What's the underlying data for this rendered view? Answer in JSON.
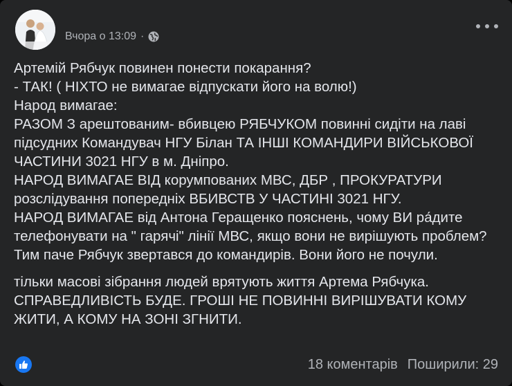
{
  "post": {
    "timestamp": "Вчора о 13:09",
    "separator": "·",
    "privacy_icon": "globe-icon",
    "more_icon": "more-options-icon",
    "lines": [
      "Артемій Рябчук повинен понести покарання?",
      "- ТАК! ( НІХТО не вимагае відпускати його на волю!)",
      "Народ вимагае:",
      "РАЗОМ З арештованим- вбивцею РЯБЧУКОМ повинні сидіти на лаві підсудних Командувач НГУ Білан ТА ІНШІ КОМАНДИРИ ВІЙСЬКОВОЇ ЧАСТИНИ 3021 НГУ в м. Дніпро.",
      "НАРОД ВИМАГАЕ ВІД корумпованих МВС, ДБР , ПРОКУРАТУРИ розслідування попередніх ВБИВСТВ У ЧАСТИНІ 3021 НГУ.",
      "НАРОД ВИМАГАЕ від Антона Геращенко пояснень, чому ВИ ра́дите телефонувати на \" гарячі\" лінії МВС, якщо вони не вирішують проблем?",
      "Тим паче Рябчук звертався до командирів. Вони його не почули."
    ],
    "lines2": [
      "тільки масові зібрання людей врятують життя Артема Рябчука.",
      "СПРАВЕДЛИВІСТЬ БУДЕ. ГРОШІ НЕ ПОВИННІ ВИРІШУВАТИ КОМУ ЖИТИ, А КОМУ НА ЗОНІ ЗГНИТИ."
    ]
  },
  "footer": {
    "reaction_icon": "thumbs-up-icon",
    "comments": "18 коментарів",
    "shares": "Поширили: 29"
  },
  "colors": {
    "background": "#242526",
    "text": "#e4e6eb",
    "secondary": "#b0b3b8",
    "like_blue": "#1877f2"
  }
}
